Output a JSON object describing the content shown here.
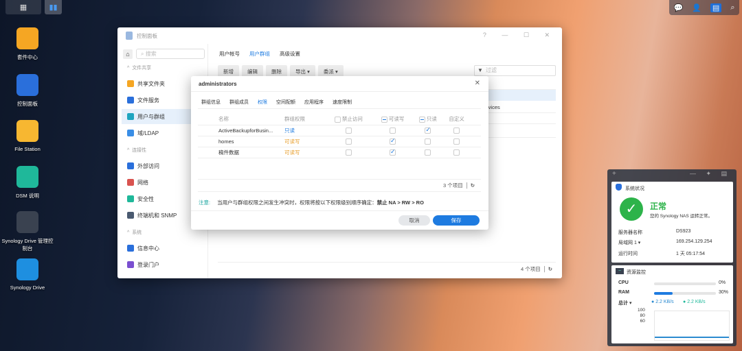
{
  "taskbar": {
    "main_menu": "main-menu",
    "active_app": "control-panel"
  },
  "tray": [
    "chat",
    "user",
    "widgets",
    "search"
  ],
  "desktop": [
    {
      "label": "套件中心",
      "color": "#f5a623"
    },
    {
      "label": "控制面板",
      "color": "#2a6fdb"
    },
    {
      "label": "File Station",
      "color": "#f7b731"
    },
    {
      "label": "DSM 说明",
      "color": "#1fb89a"
    },
    {
      "label": "Synology Drive 管理控制台",
      "color": "#3a4250"
    },
    {
      "label": "Synology Drive",
      "color": "#1e8fe0"
    }
  ],
  "window": {
    "title": "控制面板",
    "controls": "? — ☐ ✕",
    "search_placeholder": "搜索",
    "sidebar": {
      "sec1": "文件共享",
      "sec2": "连接性",
      "sec3": "系统",
      "items": [
        {
          "label": "共享文件夹",
          "color": "#f5a623"
        },
        {
          "label": "文件服务",
          "color": "#2a6fdb"
        },
        {
          "label": "用户与群组",
          "color": "#1fa5c0"
        },
        {
          "label": "域/LDAP",
          "color": "#3a8ee6"
        },
        {
          "label": "外部访问",
          "color": "#2a6fdb"
        },
        {
          "label": "网络",
          "color": "#d9534f"
        },
        {
          "label": "安全性",
          "color": "#1fb89a"
        },
        {
          "label": "终端机和 SNMP",
          "color": "#4a5a70"
        },
        {
          "label": "信息中心",
          "color": "#2a6fdb"
        },
        {
          "label": "登录门户",
          "color": "#7a4fd0"
        }
      ]
    },
    "tabs": [
      "用户帐号",
      "用户群组",
      "高级设置"
    ],
    "toolbar": [
      "新增",
      "编辑",
      "删除",
      "导出 ▾",
      "委派 ▾"
    ],
    "filter_placeholder": "过滤",
    "row_partial": "ervices",
    "count": "4 个项目"
  },
  "dialog": {
    "title": "administrators",
    "tabs": [
      "群组信息",
      "群组成员",
      "权限",
      "空间配额",
      "应用程序",
      "速度限制"
    ],
    "headers": [
      "名称",
      "群组权限",
      "禁止访问",
      "可读写",
      "只读",
      "自定义"
    ],
    "rows": [
      {
        "name": "ActiveBackupforBusin...",
        "perm": "只读",
        "type": "ro",
        "na": false,
        "rw": false,
        "ro": true,
        "custom": false
      },
      {
        "name": "homes",
        "perm": "可读写",
        "type": "rw",
        "na": false,
        "rw": true,
        "ro": false,
        "custom": false
      },
      {
        "name": "稿件数据",
        "perm": "可读写",
        "type": "rw",
        "na": false,
        "rw": true,
        "ro": false,
        "custom": false
      }
    ],
    "count": "3 个项目",
    "note_label": "注意:",
    "note_text": "当用户与群组权限之间发生冲突时，权限将按以下权限级别顺序确定：",
    "note_order": "禁止 NA > RW > RO",
    "cancel": "取消",
    "save": "保存"
  },
  "widget": {
    "status_title": "系统状况",
    "status": "正常",
    "status_desc": "您的 Synology NAS 运转正常。",
    "server_label": "服务器名称",
    "server": "DS923",
    "lan_label": "局域网 1 ▾",
    "lan": "169.254.129.254",
    "uptime_label": "运行时间",
    "uptime": "1 天 05:17:54",
    "monitor_title": "资源监控",
    "cpu_label": "CPU",
    "cpu": "0%",
    "cpu_value": 0,
    "ram_label": "RAM",
    "ram": "30%",
    "ram_value": 30,
    "total_label": "总计 ▾",
    "up": "2.2 KB/s",
    "down": "2.2 KB/s",
    "y_ticks": [
      "100",
      "80",
      "60"
    ]
  },
  "accent": "#1e7be0"
}
